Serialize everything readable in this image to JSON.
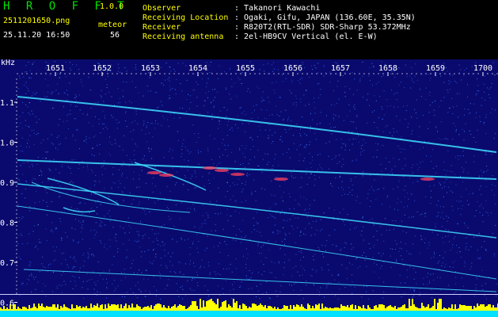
{
  "header": {
    "logo": "H R O F F T",
    "version": "1.0.0",
    "filename": "2511201650.png",
    "datetime": "25.11.20 16:50",
    "meteor_label": "meteor",
    "meteor_count": "56",
    "fields": [
      {
        "label": "Observer",
        "value": ": Takanori Kawachi"
      },
      {
        "label": "Receiving Location",
        "value": ": Ogaki, Gifu, JAPAN (136.60E, 35.35N)"
      },
      {
        "label": "Receiver",
        "value": ": R820T2(RTL-SDR) SDR-Sharp 53.372MHz"
      },
      {
        "label": "Receiving antenna",
        "value": ": 2el-HB9CV Vertical (el. E-W)"
      }
    ]
  },
  "spectrogram": {
    "y_unit": "kHz",
    "y_ticks": [
      "1.1",
      "1.0",
      "0.9",
      "0.8",
      "0.7",
      "0.6"
    ],
    "x_ticks": [
      "1651",
      "1652",
      "1653",
      "1654",
      "1655",
      "1656",
      "1657",
      "1658",
      "1659",
      "1700"
    ],
    "colors": {
      "background": "#0a0a6e",
      "noise": "#3a6cff",
      "trace": "#40e0ff",
      "hot": "#ff4060",
      "activity": "#ffff00",
      "baseline": "#00e0ff"
    }
  }
}
